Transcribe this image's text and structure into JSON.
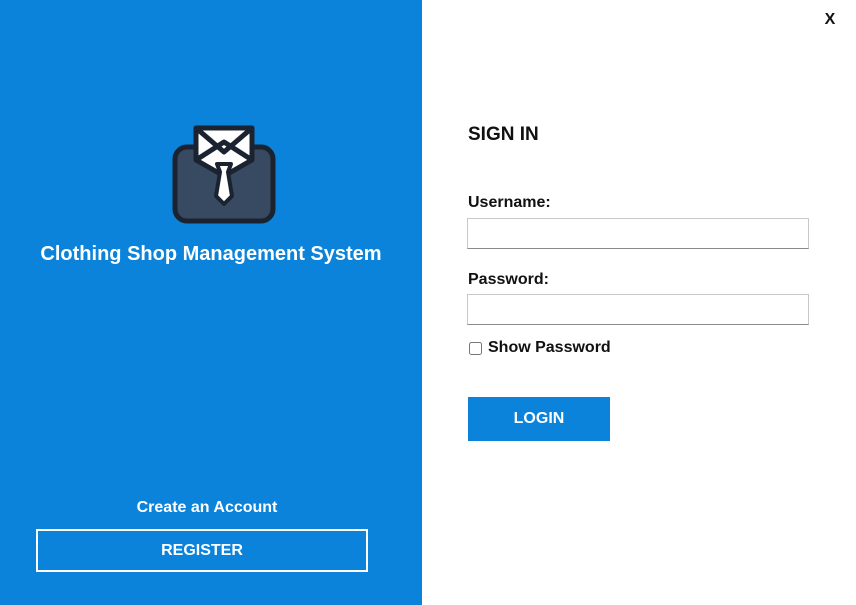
{
  "window": {
    "close_label": "X"
  },
  "left_panel": {
    "app_title": "Clothing Shop Management System",
    "logo_icon": "shirt-tie-icon",
    "create_account_text": "Create an Account",
    "register_label": "REGISTER",
    "background_color": "#0b83db"
  },
  "sign_in": {
    "title": "SIGN IN",
    "username_label": "Username:",
    "username_value": "",
    "password_label": "Password:",
    "password_value": "",
    "show_password_label": "Show Password",
    "show_password_checked": false,
    "login_label": "LOGIN",
    "accent_color": "#0b83db"
  }
}
